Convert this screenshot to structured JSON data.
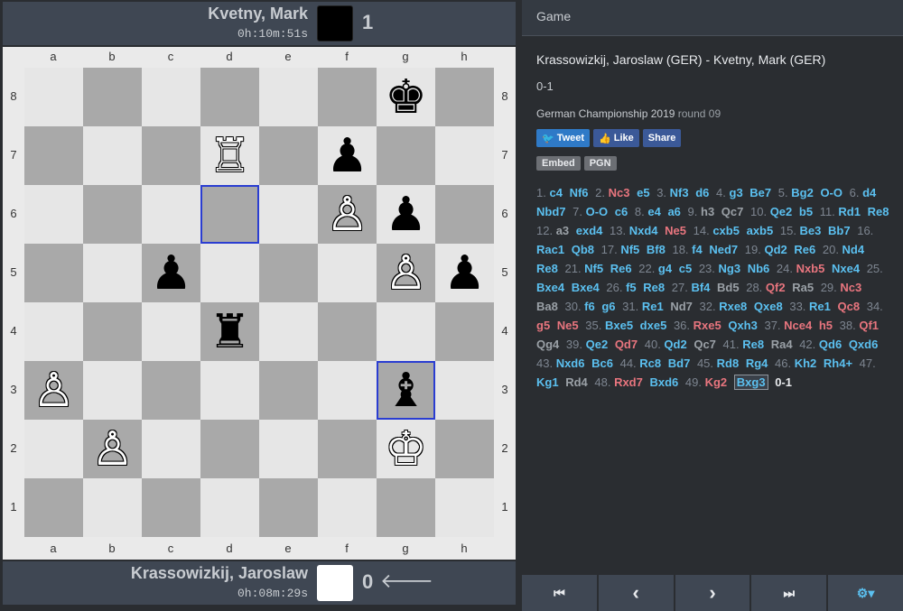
{
  "top_player": {
    "name": "Kvetny, Mark",
    "clock": "0h:10m:51s",
    "color": "#000000",
    "score": "1"
  },
  "bottom_player": {
    "name": "Krassowizkij, Jaroslaw",
    "clock": "0h:08m:29s",
    "color": "#ffffff",
    "score": "0",
    "arrow": "🡐"
  },
  "board": {
    "files": [
      "a",
      "b",
      "c",
      "d",
      "e",
      "f",
      "g",
      "h"
    ],
    "ranks": [
      "8",
      "7",
      "6",
      "5",
      "4",
      "3",
      "2",
      "1"
    ],
    "highlight": [
      "d6",
      "g3"
    ],
    "pieces": {
      "g8": {
        "glyph": "♚",
        "side": "black",
        "name": "black-king-icon"
      },
      "d7": {
        "glyph": "♖",
        "side": "white",
        "name": "white-rook-icon"
      },
      "f7": {
        "glyph": "♟",
        "side": "black",
        "name": "black-pawn-icon"
      },
      "f6": {
        "glyph": "♙",
        "side": "white",
        "name": "white-pawn-icon"
      },
      "g6": {
        "glyph": "♟",
        "side": "black",
        "name": "black-pawn-icon"
      },
      "c5": {
        "glyph": "♟",
        "side": "black",
        "name": "black-pawn-icon"
      },
      "g5": {
        "glyph": "♙",
        "side": "white",
        "name": "white-pawn-icon"
      },
      "h5": {
        "glyph": "♟",
        "side": "black",
        "name": "black-pawn-icon"
      },
      "d4": {
        "glyph": "♜",
        "side": "black",
        "name": "black-rook-icon"
      },
      "a3": {
        "glyph": "♙",
        "side": "white",
        "name": "white-pawn-icon"
      },
      "g3": {
        "glyph": "♝",
        "side": "black",
        "name": "black-bishop-icon"
      },
      "b2": {
        "glyph": "♙",
        "side": "white",
        "name": "white-pawn-icon"
      },
      "g2": {
        "glyph": "♔",
        "side": "white",
        "name": "white-king-icon"
      }
    }
  },
  "panel": {
    "header": "Game",
    "title": "Krassowizkij, Jaroslaw (GER) - Kvetny, Mark (GER)",
    "result": "0-1",
    "event": "German Championship 2019",
    "round": "round 09",
    "social": {
      "tweet": "Tweet",
      "like": "Like",
      "share": "Share"
    },
    "tools": {
      "embed": "Embed",
      "pgn": "PGN"
    }
  },
  "moves": [
    [
      "1.",
      "c4",
      "Nf6"
    ],
    [
      "2.",
      "Nc3",
      "e5"
    ],
    [
      "3.",
      "Nf3",
      "d6"
    ],
    [
      "4.",
      "g3",
      "Be7"
    ],
    [
      "5.",
      "Bg2",
      "O-O"
    ],
    [
      "6.",
      "d4",
      "Nbd7"
    ],
    [
      "7.",
      "O-O",
      "c6"
    ],
    [
      "8.",
      "e4",
      "a6"
    ],
    [
      "9.",
      "h3",
      "Qc7"
    ],
    [
      "10.",
      "Qe2",
      "b5"
    ],
    [
      "11.",
      "Rd1",
      "Re8"
    ],
    [
      "12.",
      "a3",
      "exd4"
    ],
    [
      "13.",
      "Nxd4",
      "Ne5"
    ],
    [
      "14.",
      "cxb5",
      "axb5"
    ],
    [
      "15.",
      "Be3",
      "Bb7"
    ],
    [
      "16.",
      "Rac1",
      "Qb8"
    ],
    [
      "17.",
      "Nf5",
      "Bf8"
    ],
    [
      "18.",
      "f4",
      "Ned7"
    ],
    [
      "19.",
      "Qd2",
      "Re6"
    ],
    [
      "20.",
      "Nd4",
      "Re8"
    ],
    [
      "21.",
      "Nf5",
      "Re6"
    ],
    [
      "22.",
      "g4",
      "c5"
    ],
    [
      "23.",
      "Ng3",
      "Nb6"
    ],
    [
      "24.",
      "Nxb5",
      "Nxe4"
    ],
    [
      "25.",
      "Bxe4",
      "Bxe4"
    ],
    [
      "26.",
      "f5",
      "Re8"
    ],
    [
      "27.",
      "Bf4",
      "Bd5"
    ],
    [
      "28.",
      "Qf2",
      "Ra5"
    ],
    [
      "29.",
      "Nc3",
      "Ba8"
    ],
    [
      "30.",
      "f6",
      "g6"
    ],
    [
      "31.",
      "Re1",
      "Nd7"
    ],
    [
      "32.",
      "Rxe8",
      "Qxe8"
    ],
    [
      "33.",
      "Re1",
      "Qc8"
    ],
    [
      "34.",
      "g5",
      "Ne5"
    ],
    [
      "35.",
      "Bxe5",
      "dxe5"
    ],
    [
      "36.",
      "Rxe5",
      "Qxh3"
    ],
    [
      "37.",
      "Nce4",
      "h5"
    ],
    [
      "38.",
      "Qf1",
      "Qg4"
    ],
    [
      "39.",
      "Qe2",
      "Qd7"
    ],
    [
      "40.",
      "Qd2",
      "Qc7"
    ],
    [
      "41.",
      "Re8",
      "Ra4"
    ],
    [
      "42.",
      "Qd6",
      "Qxd6"
    ],
    [
      "43.",
      "Nxd6",
      "Bc6"
    ],
    [
      "44.",
      "Rc8",
      "Bd7"
    ],
    [
      "45.",
      "Rd8",
      "Rg4"
    ],
    [
      "46.",
      "Kh2",
      "Rh4+"
    ],
    [
      "47.",
      "Kg1",
      "Rd4"
    ],
    [
      "48.",
      "Rxd7",
      "Bxd6"
    ],
    [
      "49.",
      "Kg2",
      "Bxg3"
    ]
  ],
  "move_colors": {
    "normal": "#5bc0f0",
    "red": "#e8757e",
    "gray": "#9aa0a6"
  },
  "red_moves": [
    "Nxb5",
    "Qf2",
    "Nc3",
    "Qc8",
    "g5",
    "Ne5",
    "Rxe5",
    "Nce4",
    "h5",
    "Qf1",
    "Qd7",
    "Rxd7",
    "Kg2"
  ],
  "gray_moves": [
    "h3",
    "Qc7",
    "a3",
    "Bd5",
    "Ra5",
    "Ba8",
    "Nd7",
    "Ra4",
    "Rd4",
    "Qg4"
  ],
  "current_move": "Bxg3",
  "final_result": "0-1",
  "nav": {
    "first": "⏮",
    "prev": "‹",
    "next": "›",
    "last": "⏭",
    "settings": "⚙▾"
  }
}
